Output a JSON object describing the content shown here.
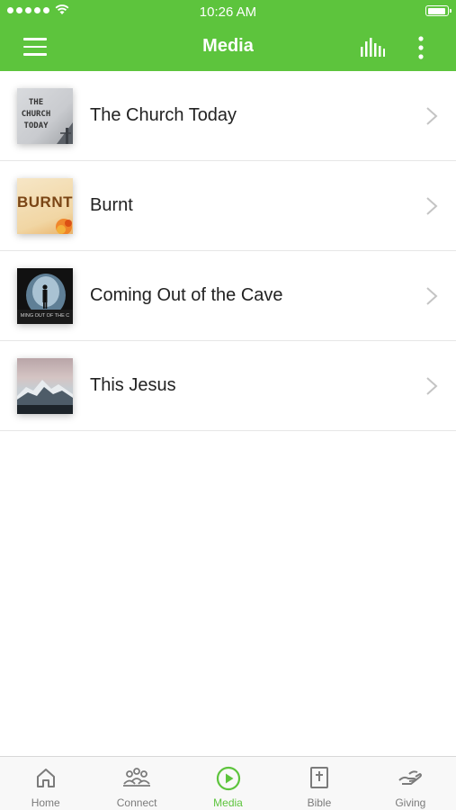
{
  "status_bar": {
    "time": "10:26 AM",
    "battery_level": 0.95
  },
  "header": {
    "title": "Media"
  },
  "media_items": [
    {
      "title": "The Church Today",
      "thumb_caption": "THE\nCHURCH\nTODAY"
    },
    {
      "title": "Burnt",
      "thumb_caption": "BURNT"
    },
    {
      "title": "Coming Out of the Cave",
      "thumb_caption": "MING OUT OF THE C"
    },
    {
      "title": "This Jesus",
      "thumb_caption": ""
    }
  ],
  "tabs": [
    {
      "label": "Home",
      "icon": "home-icon",
      "active": false
    },
    {
      "label": "Connect",
      "icon": "people-icon",
      "active": false
    },
    {
      "label": "Media",
      "icon": "play-circle-icon",
      "active": true
    },
    {
      "label": "Bible",
      "icon": "bible-icon",
      "active": false
    },
    {
      "label": "Giving",
      "icon": "giving-hand-icon",
      "active": false
    }
  ],
  "colors": {
    "accent": "#5dc43d",
    "tab_inactive": "#7b7b7b"
  }
}
